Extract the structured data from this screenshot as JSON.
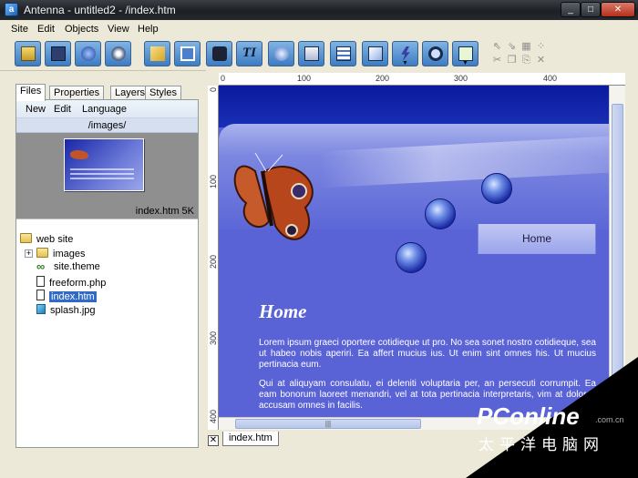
{
  "window": {
    "title": "Antenna - untitled2 - /index.htm"
  },
  "menu": [
    "Site",
    "Edit",
    "Objects",
    "View",
    "Help"
  ],
  "toolbar_icons": [
    "open-site-icon",
    "save-icon",
    "publish-icon",
    "preview-icon",
    "edit-link-icon",
    "rectangle-icon",
    "camera-icon",
    "text-icon",
    "button-icon",
    "layers-icon",
    "form-icon",
    "media-icon",
    "lightning-icon",
    "find-icon",
    "checkbox-icon"
  ],
  "left_panel": {
    "tabs": [
      "Files",
      "Properties",
      "Layers",
      "Styles"
    ],
    "subtool": [
      "New",
      "Edit",
      "Language"
    ],
    "folder_path": "/images/",
    "preview_filename": "index.htm 5K",
    "tree": [
      {
        "label": "web site",
        "icon": "folder-icon",
        "level": 0
      },
      {
        "label": "images",
        "icon": "folder-icon",
        "level": 1
      },
      {
        "label": "site.theme",
        "icon": "theme-icon",
        "level": 1
      },
      {
        "label": "freeform.php",
        "icon": "file-icon",
        "level": 1
      },
      {
        "label": "index.htm",
        "icon": "file-icon",
        "level": 1,
        "selected": true
      },
      {
        "label": "splash.jpg",
        "icon": "image-icon",
        "level": 1
      }
    ]
  },
  "rulers": {
    "h": [
      "0",
      "100",
      "200",
      "300",
      "400"
    ],
    "v": [
      "0",
      "100",
      "200",
      "300",
      "400"
    ]
  },
  "canvas": {
    "nav_button": "Home",
    "heading": "Home",
    "para1": "Lorem ipsum graeci oportere cotidieque ut pro. No sea sonet nostro cotidieque, sea ut habeo nobis aperiri. Ea affert mucius ius. Ut enim sint omnes his. Ut mucius pertinacia eum.",
    "para2": "Qui at aliquyam consulatu, ei deleniti voluptaria per, an persecuti corrumpit. Ea eam bonorum laoreet menandri, vel at tota pertinacia interpretaris, vim at dolores accusam omnes in facilis."
  },
  "document_tab": "index.htm",
  "watermark": {
    "logo": "PConline",
    "domain": ".com.cn",
    "cn": "太平洋电脑网"
  }
}
